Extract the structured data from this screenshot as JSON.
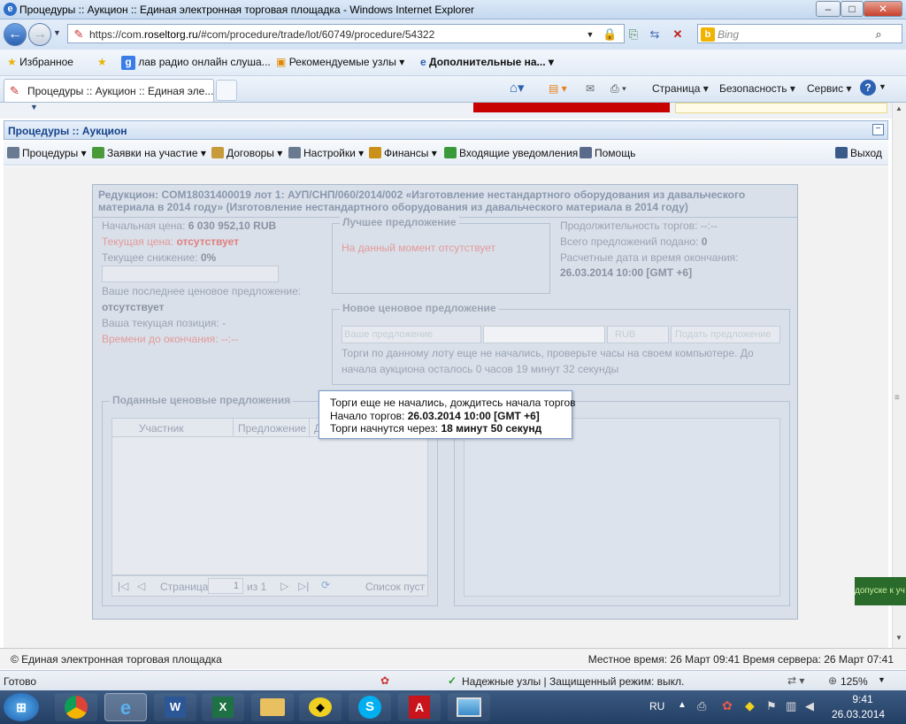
{
  "window": {
    "title": "Процедуры :: Аукцион :: Единая электронная торговая площадка - Windows Internet Explorer",
    "minimize": "–",
    "maximize": "□",
    "close": "✕"
  },
  "address": {
    "url_prefix": "https://com.",
    "url_host": "roseltorg.ru",
    "url_path": "/#com/procedure/trade/lot/60749/procedure/54322",
    "search_placeholder": "Bing"
  },
  "favorites": {
    "label": "Избранное",
    "items": [
      "лав радио онлайн слуша...",
      "Рекомендуемые узлы ▾",
      "Дополнительные на... ▾"
    ]
  },
  "tab": {
    "title": "Процедуры :: Аукцион :: Единая эле..."
  },
  "commands": {
    "page": "Страница ▾",
    "safety": "Безопасность ▾",
    "service": "Сервис ▾"
  },
  "app": {
    "header_title": "Процедуры :: Аукцион",
    "menu": [
      {
        "label": "Процедуры ▾",
        "icon": "gear-icon",
        "color": "#6a7a90"
      },
      {
        "label": "Заявки на участие ▾",
        "icon": "calculator-icon",
        "color": "#4a9a3a"
      },
      {
        "label": "Договоры ▾",
        "icon": "handshake-icon",
        "color": "#c79a3a"
      },
      {
        "label": "Настройки ▾",
        "icon": "wrench-icon",
        "color": "#6a7a90"
      },
      {
        "label": "Финансы ▾",
        "icon": "bank-icon",
        "color": "#c9901a"
      },
      {
        "label": "Входящие уведомления",
        "icon": "inbox-icon",
        "color": "#3a9a3a"
      },
      {
        "label": "Помощь",
        "icon": "help-icon",
        "color": "#5a6a8a"
      }
    ],
    "exit": "Выход"
  },
  "auction": {
    "header": "Редукцион: COM18031400019 лот 1: АУП/СНП/060/2014/002 «Изготовление нестандартного оборудования из давальческого материала в 2014 году» (Изготовление нестандартного оборудования из давальческого материала в 2014 году)",
    "start_price_label": "Начальная цена:",
    "start_price_value": "6 030 952,10 RUB",
    "current_price_label": "Текущая цена:",
    "current_price_value": "отсутствует",
    "current_decrease_label": "Текущее снижение:",
    "current_decrease_value": "0%",
    "last_offer_label": "Ваше последнее ценовое предложение:",
    "last_offer_value": "отсутствует",
    "position_label": "Ваша текущая позиция:",
    "position_value": "-",
    "time_left_label": "Времени до окончания:",
    "time_left_value": "--:--",
    "best_offer_title": "Лучшее предложение",
    "best_offer_text": "На данный момент отсутствует",
    "duration_label": "Продолжительность торгов:",
    "duration_value": "--:--",
    "total_offers_label": "Всего предложений подано:",
    "total_offers_value": "0",
    "end_date_label": "Расчетные дата и время окончания:",
    "end_date_value": "26.03.2014 10:00 [GMT +6]",
    "new_offer_title": "Новое ценовое предложение",
    "your_offer_label": "Ваше предложение",
    "currency": "RUB",
    "submit_label": "Подать предложение",
    "not_started_text1": "Торги по данному лоту еще не начались, проверьте часы на своем компьютере. До",
    "not_started_text2": "начала аукциона осталось 0 часов 19 минут 32 секунды",
    "offers_title": "Поданные ценовые предложения",
    "columns": [
      "Участник",
      "Предложение",
      "Д"
    ],
    "pager_page": "Страница",
    "pager_value": "1",
    "pager_of": "из 1",
    "pager_empty": "Список пуст"
  },
  "tooltip": {
    "line1": "Торги еще не начались, дождитесь начала торгов",
    "line2_label": "Начало торгов:",
    "line2_value": "26.03.2014 10:00 [GMT +6]",
    "line3_label": "Торги начнутся через:",
    "line3_value": "18 минут 50 секунд"
  },
  "footer": {
    "copyright": "© Единая электронная торговая площадка",
    "time": "Местное время: 26 Март 09:41 Время сервера: 26 Март 07:41"
  },
  "status": {
    "ready": "Готово",
    "zone": "Надежные узлы | Защищенный режим: выкл.",
    "zoom": "125%"
  },
  "side_badge": "допуске к уч",
  "taskbar": {
    "lang": "RU",
    "time": "9:41",
    "date": "26.03.2014"
  }
}
